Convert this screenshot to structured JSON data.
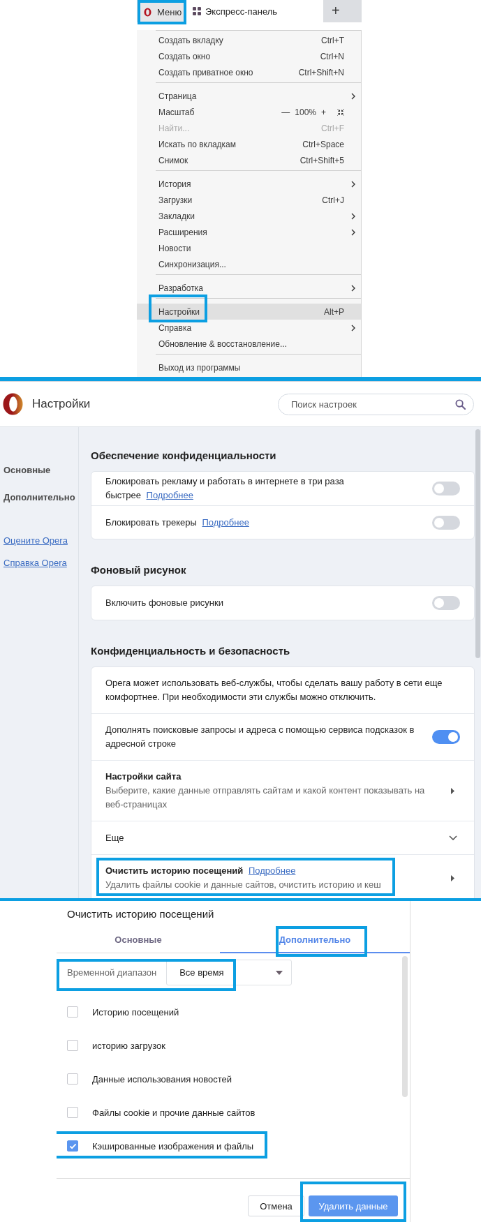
{
  "browser_tab_bar": {
    "menu_button": {
      "label": "Меню",
      "highlighted": true
    },
    "tabs": [
      {
        "label": "Экспресс-панель",
        "selected": true
      }
    ],
    "new_tab": "+"
  },
  "main_menu": {
    "groups": [
      {
        "items": [
          {
            "kind": "command",
            "label": "Создать вкладку",
            "shortcut": "Ctrl+T",
            "disabled": false,
            "selected": false,
            "highlighted": false
          },
          {
            "kind": "command",
            "label": "Создать окно",
            "shortcut": "Ctrl+N",
            "disabled": false,
            "selected": false,
            "highlighted": false
          },
          {
            "kind": "command",
            "label": "Создать приватное окно",
            "shortcut": "Ctrl+Shift+N",
            "disabled": false,
            "selected": false,
            "highlighted": false
          }
        ]
      },
      {
        "items": [
          {
            "kind": "submenu",
            "label": "Страница",
            "disabled": false,
            "selected": false,
            "highlighted": false
          },
          {
            "kind": "zoom",
            "label": "Масштаб",
            "zoom_out": "—",
            "value": "100%",
            "zoom_in": "+",
            "disabled": false,
            "selected": false,
            "highlighted": false
          },
          {
            "kind": "command",
            "label": "Найти...",
            "shortcut": "Ctrl+F",
            "disabled": true,
            "selected": false,
            "highlighted": false
          },
          {
            "kind": "command",
            "label": "Искать по вкладкам",
            "shortcut": "Ctrl+Space",
            "disabled": false,
            "selected": false,
            "highlighted": false
          },
          {
            "kind": "command",
            "label": "Снимок",
            "shortcut": "Ctrl+Shift+5",
            "disabled": false,
            "selected": false,
            "highlighted": false
          }
        ]
      },
      {
        "items": [
          {
            "kind": "submenu",
            "label": "История",
            "disabled": false,
            "selected": false,
            "highlighted": false
          },
          {
            "kind": "command",
            "label": "Загрузки",
            "shortcut": "Ctrl+J",
            "disabled": false,
            "selected": false,
            "highlighted": false
          },
          {
            "kind": "submenu",
            "label": "Закладки",
            "disabled": false,
            "selected": false,
            "highlighted": false
          },
          {
            "kind": "submenu",
            "label": "Расширения",
            "disabled": false,
            "selected": false,
            "highlighted": false
          },
          {
            "kind": "command",
            "label": "Новости",
            "disabled": false,
            "selected": false,
            "highlighted": false
          },
          {
            "kind": "command",
            "label": "Синхронизация...",
            "disabled": false,
            "selected": false,
            "highlighted": false
          }
        ]
      },
      {
        "items": [
          {
            "kind": "submenu",
            "label": "Разработка",
            "disabled": false,
            "selected": false,
            "highlighted": false
          }
        ]
      },
      {
        "items": [
          {
            "kind": "command",
            "label": "Настройки",
            "shortcut": "Alt+P",
            "disabled": false,
            "selected": true,
            "highlighted": true
          },
          {
            "kind": "submenu",
            "label": "Справка",
            "disabled": false,
            "selected": false,
            "highlighted": false
          },
          {
            "kind": "command",
            "label": "Обновление & восстановление...",
            "disabled": false,
            "selected": false,
            "highlighted": false
          }
        ]
      },
      {
        "items": [
          {
            "kind": "command",
            "label": "Выход из программы",
            "disabled": false,
            "selected": false,
            "highlighted": false
          }
        ]
      }
    ]
  },
  "settings": {
    "header": {
      "title": "Настройки",
      "search": {
        "placeholder": "Поиск настроек"
      }
    },
    "sidebar": {
      "nav": [
        {
          "label": "Основные"
        },
        {
          "label": "Дополнительно"
        }
      ],
      "links": [
        {
          "label": "Оцените Opera"
        },
        {
          "label": "Справка Opera"
        }
      ]
    },
    "sections": [
      {
        "title": "Обеспечение конфиденциальности",
        "rows": [
          {
            "kind": "toggle",
            "text": "Блокировать рекламу и работать в интернете в три раза быстрее",
            "link": "Подробнее",
            "on": false,
            "highlighted": false
          },
          {
            "kind": "toggle",
            "text": "Блокировать трекеры",
            "link": "Подробнее",
            "on": false,
            "highlighted": false
          }
        ]
      },
      {
        "title": "Фоновый рисунок",
        "rows": [
          {
            "kind": "toggle",
            "text": "Включить фоновые рисунки",
            "on": false,
            "highlighted": false
          }
        ]
      },
      {
        "title": "Конфиденциальность и безопасность",
        "rows": [
          {
            "kind": "info",
            "text": "Opera может использовать веб-службы, чтобы сделать вашу работу в сети еще комфортнее. При необходимости эти службы можно отключить.",
            "highlighted": false
          },
          {
            "kind": "toggle",
            "text": "Дополнять поисковые запросы и адреса с помощью сервиса подсказок в адресной строке",
            "on": true,
            "highlighted": false
          },
          {
            "kind": "nav",
            "title": "Настройки сайта",
            "description": "Выберите, какие данные отправлять сайтам и какой контент показывать на веб-страницах",
            "highlighted": false
          },
          {
            "kind": "expand",
            "text": "Еще",
            "expanded": false,
            "highlighted": false
          },
          {
            "kind": "nav",
            "title": "Очистить историю посещений",
            "link": "Подробнее",
            "description": "Удалить файлы cookie и данные сайтов, очистить историю и кеш",
            "highlighted": true
          }
        ]
      }
    ]
  },
  "clear_data_dialog": {
    "title": "Очистить историю посещений",
    "tabs": [
      {
        "label": "Основные",
        "selected": false,
        "highlighted": false
      },
      {
        "label": "Дополнительно",
        "selected": true,
        "highlighted": true
      }
    ],
    "time_range": {
      "label": "Временной диапазон",
      "value": "Все время",
      "highlighted": true
    },
    "options": [
      {
        "label": "Историю посещений",
        "checked": false,
        "highlighted": false
      },
      {
        "label": "историю загрузок",
        "checked": false,
        "highlighted": false
      },
      {
        "label": "Данные использования новостей",
        "checked": false,
        "highlighted": false
      },
      {
        "label": "Файлы cookie и прочие данные сайтов",
        "checked": false,
        "highlighted": false
      },
      {
        "label": "Кэшированные изображения и файлы",
        "checked": true,
        "highlighted": true
      }
    ],
    "buttons": [
      {
        "kind": "cancel",
        "label": "Отмена",
        "highlighted": false
      },
      {
        "kind": "delete",
        "label": "Удалить данные",
        "highlighted": true
      }
    ]
  }
}
